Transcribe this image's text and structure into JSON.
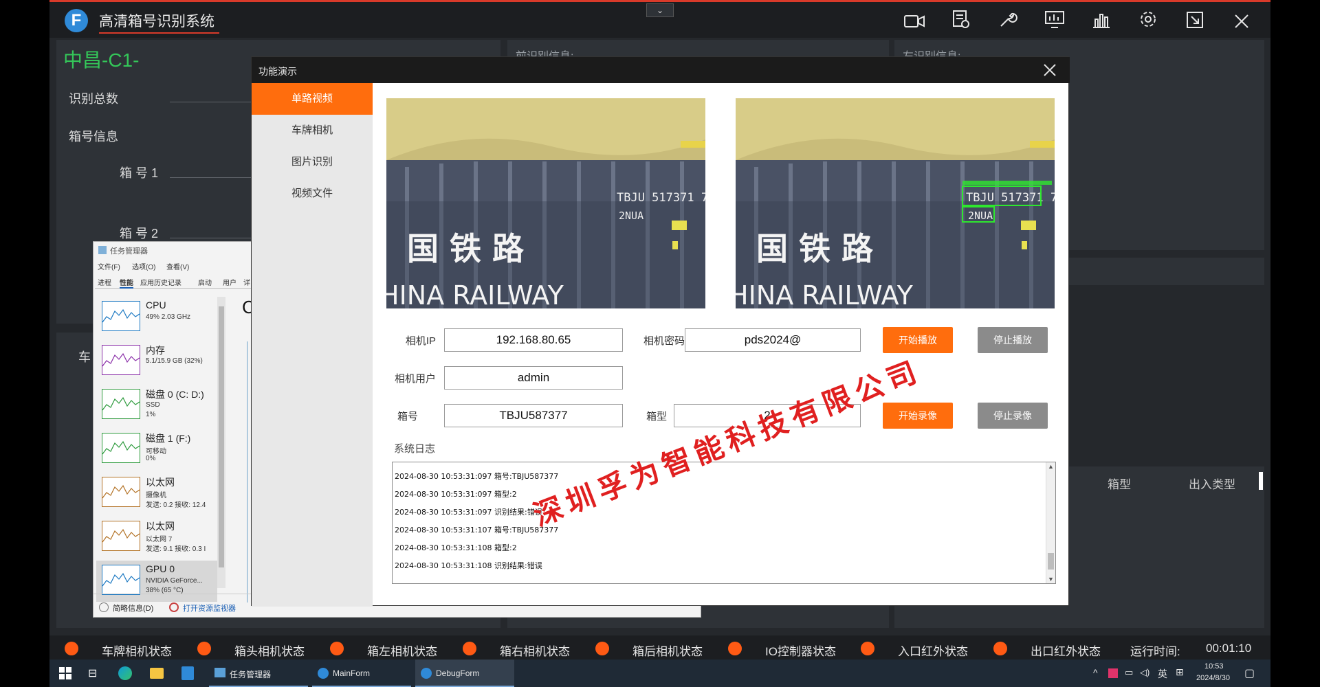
{
  "app": {
    "title": "高清箱号识别系统",
    "station": "中昌-C1-",
    "labels": {
      "total": "识别总数",
      "box_info": "箱号信息",
      "box1": "箱 号 1",
      "box2": "箱 号 2",
      "front_info": "前识别信息:",
      "left_info": "左识别信息:",
      "col_box_type": "箱型",
      "col_inout": "出入类型",
      "car_partial": "车"
    },
    "icons": [
      "video-icon",
      "report-icon",
      "wrench-icon",
      "monitor-chart-icon",
      "bar-chart-icon",
      "gear-icon",
      "exit-icon",
      "close-icon"
    ],
    "collapse_icon": "chevron-down-icon"
  },
  "status_bar": {
    "items": [
      "车牌相机状态",
      "箱头相机状态",
      "箱左相机状态",
      "箱右相机状态",
      "箱后相机状态",
      "IO控制器状态",
      "入口红外状态",
      "出口红外状态"
    ],
    "dot_color": "#ff5a14",
    "runtime_label": "运行时间:",
    "runtime_value": "00:01:10"
  },
  "task_manager": {
    "title": "任务管理器",
    "menu": [
      "文件(F)",
      "选项(O)",
      "查看(V)"
    ],
    "tabs": [
      "进程",
      "性能",
      "应用历史记录",
      "启动",
      "用户",
      "详"
    ],
    "active_tab": "性能",
    "resources": [
      {
        "name": "CPU",
        "line1": "49%  2.03 GHz",
        "line2": ""
      },
      {
        "name": "内存",
        "line1": "5.1/15.9 GB (32%)",
        "line2": ""
      },
      {
        "name": "磁盘 0 (C: D:)",
        "line1": "SSD",
        "line2": "1%"
      },
      {
        "name": "磁盘 1 (F:)",
        "line1": "可移动",
        "line2": "0%"
      },
      {
        "name": "以太网",
        "line1": "摄像机",
        "line2": "发送: 0.2  接收: 12.4"
      },
      {
        "name": "以太网",
        "line1": "以太网 7",
        "line2": "发送: 9.1  接收: 0.3 I"
      },
      {
        "name": "GPU 0",
        "line1": "NVIDIA GeForce...",
        "line2": "38% (65 °C)"
      }
    ],
    "big_letter": "C",
    "brief_label": "简略信息(D)",
    "monitor_link": "打开资源监视器"
  },
  "dialog": {
    "title": "功能演示",
    "side_items": [
      "单路视频",
      "车牌相机",
      "图片识别",
      "视频文件"
    ],
    "active_side": 0,
    "camera_ip_label": "相机IP",
    "camera_ip": "192.168.80.65",
    "camera_pwd_label": "相机密码",
    "camera_pwd": "pds2024@",
    "camera_user_label": "相机用户",
    "camera_user": "admin",
    "box_no_label": "箱号",
    "box_no": "TBJU587377",
    "box_type_label": "箱型",
    "box_type": "2",
    "btn_start_play": "开始播放",
    "btn_stop_play": "停止播放",
    "btn_start_rec": "开始录像",
    "btn_stop_rec": "停止录像",
    "log_label": "系统日志",
    "log_lines": [
      "2024-08-30 10:53:31:097 箱号:TBJU587377",
      "2024-08-30 10:53:31:097 箱型:2",
      "2024-08-30 10:53:31:097 识别结果:错误",
      "2024-08-30 10:53:31:107 箱号:TBJU587377",
      "2024-08-30 10:53:31:108 箱型:2",
      "2024-08-30 10:53:31:108 识别结果:错误"
    ],
    "image_text": {
      "code_line1": "TBJU 517371 7",
      "code_line2": "2NUA",
      "chars": "国 铁 路",
      "railway": "HINA RAILWAY"
    },
    "watermark": "深圳孚为智能科技有限公司"
  },
  "taskbar": {
    "apps": [
      "任务管理器",
      "MainForm",
      "DebugForm"
    ],
    "active_app": "DebugForm",
    "ime": "英",
    "time": "10:53",
    "date": "2024/8/30"
  }
}
